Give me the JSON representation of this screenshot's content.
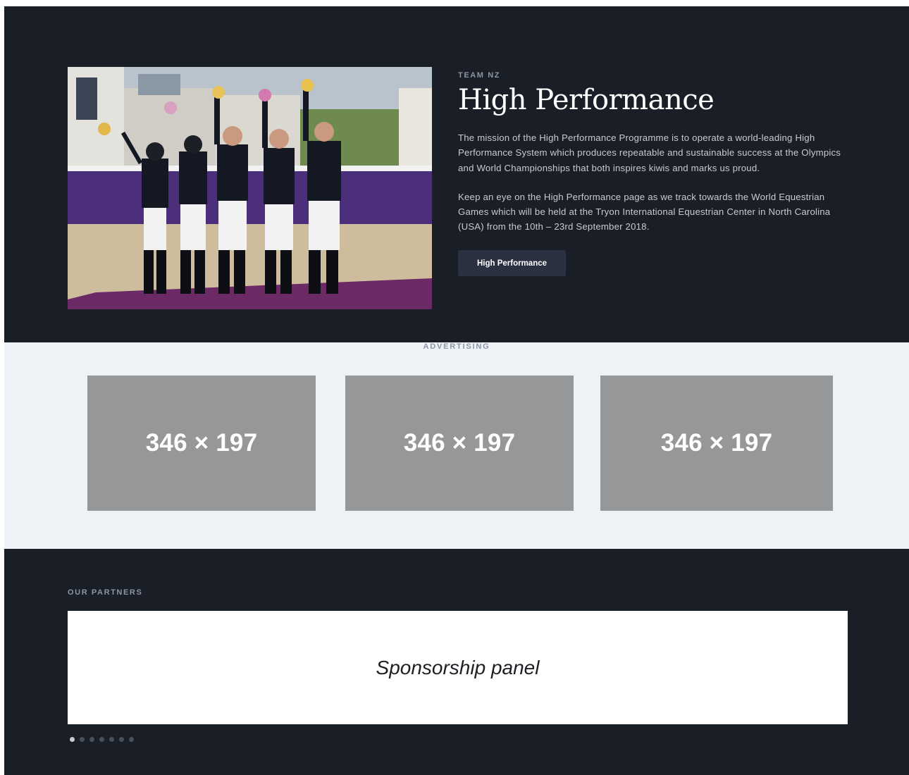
{
  "hero": {
    "eyebrow": "TEAM NZ",
    "title": "High Performance",
    "paragraphs": [
      "The mission of the High Performance Programme is to operate a world-leading High Performance System which produces repeatable and sustainable success at the Olympics and World Championships that both inspires kiwis and marks us proud.",
      "Keep an eye on the High Performance page as we track towards the World Equestrian Games which will be held at the Tryon International Equestrian Center in North Carolina (USA) from the 10th – 23rd September 2018."
    ],
    "button_label": "High Performance",
    "photo_icon": "team-photo-image"
  },
  "ads": {
    "label": "ADVERTISING",
    "slots": [
      {
        "label": "346 × 197"
      },
      {
        "label": "346 × 197"
      },
      {
        "label": "346 × 197"
      }
    ]
  },
  "partners": {
    "label": "OUR PARTNERS",
    "panel_text": "Sponsorship panel",
    "dot_count": 7,
    "active_dot": 1
  },
  "colors": {
    "dark_bg": "#1a1e27",
    "ads_bg": "#eef2f7",
    "ad_slot": "#969799",
    "button_bg": "#2b3140"
  }
}
